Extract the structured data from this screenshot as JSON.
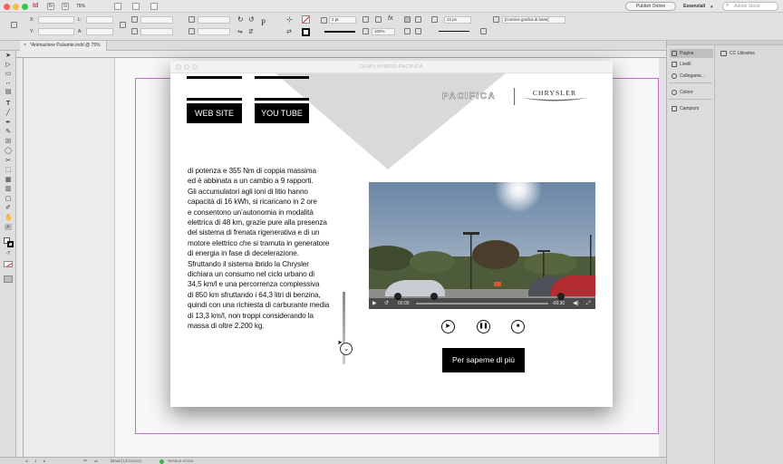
{
  "appbar": {
    "app_icon": "Id",
    "icons": [
      "Br",
      "St"
    ],
    "zoom": "75%",
    "publish_label": "Publish Online",
    "workspace_label": "Essenziali",
    "stock_placeholder": "Adobe Stock"
  },
  "control": {
    "x_label": "X:",
    "y_label": "Y:",
    "w_label": "L:",
    "h_label": "A:",
    "stroke_weight": "1 pt",
    "size_value": "12 px",
    "percent_value": "100%",
    "frame_style": "[Cornice grafica di base]"
  },
  "tab": {
    "label": "*Animazione Pulsante.indd @ 75%"
  },
  "status": {
    "page": "1",
    "style": "[Base] (di lavoro)",
    "errors": "Nessun errore"
  },
  "panels": {
    "items": [
      {
        "label": "Pagine",
        "icon": "pages-icon"
      },
      {
        "label": "Livelli",
        "icon": "layers-icon"
      },
      {
        "label": "Collegame...",
        "icon": "links-icon"
      },
      {
        "label": "Colore",
        "icon": "color-icon"
      },
      {
        "label": "Campioni",
        "icon": "swatches-icon"
      }
    ],
    "cc_libraries": "CC Libraries"
  },
  "preview": {
    "window_title": "DEMO HYBRID PACIFICA",
    "brand_left": "PACIFICA",
    "brand_right": "CHRYSLER",
    "buttons": {
      "website": "WEB SITE",
      "youtube": "YOU TUBE"
    },
    "body_lines": [
      "di potenza e 355 Nm di coppia massima",
      "ed è abbinata a un cambio a 9 rapporti.",
      "Gli accumulatori agli ioni di litio hanno",
      "capacità di 16 kWh, si ricaricano in 2 ore",
      "e consentono un’autonomia in modalità",
      "elettrica di 48 km, grazie pure alla presenza",
      "del sistema di frenata rigenerativa e di un",
      "motore elettrico che si tramuta in generatore",
      "di energia in fase di decelerazione.",
      "Sfruttando il sistema ibrido la Chrysler",
      "dichiara un consumo nel ciclo urbano di",
      "34,5 km/l e una percorrenza complessiva",
      "di 850 km sfruttando i 64,3 litri di benzina,",
      "quindi con una richiesta di carburante media",
      "di 13,3 km/l, non troppi considerando la",
      "massa di oltre 2.200 kg."
    ],
    "video": {
      "time_elapsed": "00:00",
      "time_remaining": "-00:30"
    },
    "cta_label": "Per saperne di più"
  },
  "colors": {
    "accent_margin": "#c56cc8",
    "button_bg": "#000000",
    "button_text": "#ffffff"
  }
}
